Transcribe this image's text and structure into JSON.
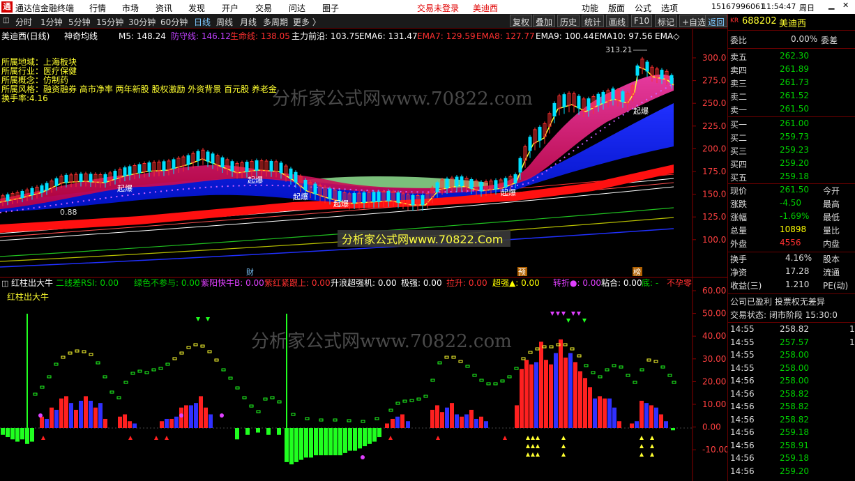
{
  "titlebar": {
    "app": "通达信金融终端",
    "menus": [
      "行情",
      "市场",
      "资讯",
      "发现",
      "开户",
      "交易",
      "问达",
      "圈子"
    ],
    "login": "交易未登录",
    "stock": "美迪西",
    "right_menus": [
      "功能",
      "版面",
      "公式",
      "选项"
    ],
    "phone": "15167996061",
    "time": "11:54:47",
    "weekday": "周日"
  },
  "toolbar": {
    "periods": [
      "分时",
      "1分钟",
      "5分钟",
      "15分钟",
      "30分钟",
      "60分钟",
      "日线",
      "周线",
      "月线",
      "多周期",
      "更多 〉"
    ],
    "selected": "日线",
    "buttons": [
      "复权",
      "叠加",
      "历史",
      "统计",
      "画线",
      "F10",
      "标记",
      "+自选",
      "返回"
    ]
  },
  "kline": {
    "name": "美迪西(日线)",
    "indicator": "神奇均线",
    "ma": [
      {
        "label": "M5: 148.24",
        "color": "#ffffff"
      },
      {
        "label": "防守线: 146.12",
        "color": "#c040ff"
      },
      {
        "label": "生命线: 138.05",
        "color": "#ff3030"
      },
      {
        "label": "主力前沿: 103.75",
        "color": "#ffffff"
      },
      {
        "label": "EMA6: 131.47",
        "color": "#ffffff"
      },
      {
        "label": "EMA7: 129.59",
        "color": "#ff3030"
      },
      {
        "label": "EMA8: 127.77",
        "color": "#ff3030"
      },
      {
        "label": "EMA9: 100.44",
        "color": "#ffffff"
      },
      {
        "label": "EMA10: 97.56",
        "color": "#ffffff"
      },
      {
        "label": "EMA◇",
        "color": "#ffffff"
      }
    ],
    "info": [
      "所属地域：上海板块",
      "所属行业：医疗保健",
      "所属概念：仿制药",
      "所属风格：融资融券 高市净率 两年新股 股权激励 外资背景 百元股 养老金",
      "换手率:4.16"
    ],
    "yticks": [
      "300.0",
      "275.0",
      "250.0",
      "225.0",
      "200.0",
      "175.0",
      "150.0",
      "125.0",
      "100.0"
    ],
    "high": "313.21",
    "low": "0.88",
    "marks": [
      "财",
      "预",
      "榜"
    ],
    "tags": [
      "起爆",
      "起爆",
      "起爆",
      "起爆",
      "起爆",
      "起爆"
    ]
  },
  "sub": {
    "name": "红柱出大牛",
    "items": [
      {
        "label": "二线差RSI: 0.00",
        "color": "#00d000"
      },
      {
        "label": "绿色不参与: 0.00",
        "color": "#00d000"
      },
      {
        "label": "紫阳快牛B: 0.00",
        "color": "#e040ff"
      },
      {
        "label": "紫红紧跟上: 0.00",
        "color": "#ff3030"
      },
      {
        "label": "升浪超强机: 0.00",
        "color": "#ffffff"
      },
      {
        "label": "极强: 0.00",
        "color": "#ffffff"
      },
      {
        "label": "拉升: 0.00",
        "color": "#ff3030"
      },
      {
        "label": "超强▲: 0.00",
        "color": "#ffff00"
      },
      {
        "label": "转折●: 0.00",
        "color": "#e040ff"
      },
      {
        "label": "粘合: 0.00",
        "color": "#ffffff"
      },
      {
        "label": "底: -",
        "color": "#00d000"
      },
      {
        "label": "不孕零",
        "color": "#ff3030"
      }
    ],
    "title": "红柱出大牛",
    "yticks": [
      "60.00",
      "50.00",
      "40.00",
      "30.00",
      "20.00",
      "10.00",
      "0.00",
      "-10.00"
    ]
  },
  "watermark": "分析家公式网www.70822.com",
  "watermark2": "分析家公式网www.70822.Com",
  "quote": {
    "market": "KR",
    "code": "688202",
    "name": "美迪西",
    "wb_label": "委比",
    "wb": "0.00%",
    "wc_label": "委差",
    "asks": [
      {
        "l": "卖五",
        "p": "262.30"
      },
      {
        "l": "卖四",
        "p": "261.89"
      },
      {
        "l": "卖三",
        "p": "261.73"
      },
      {
        "l": "卖二",
        "p": "261.52"
      },
      {
        "l": "卖一",
        "p": "261.50"
      }
    ],
    "bids": [
      {
        "l": "买一",
        "p": "261.00"
      },
      {
        "l": "买二",
        "p": "259.73"
      },
      {
        "l": "买三",
        "p": "259.23"
      },
      {
        "l": "买四",
        "p": "259.20"
      },
      {
        "l": "买五",
        "p": "259.18"
      }
    ],
    "stats": [
      {
        "l": "现价",
        "v": "261.50",
        "r": "今开",
        "c": "g"
      },
      {
        "l": "涨跌",
        "v": "-4.50",
        "r": "最高",
        "c": "g"
      },
      {
        "l": "涨幅",
        "v": "-1.69%",
        "r": "最低",
        "c": "g"
      },
      {
        "l": "总量",
        "v": "10898",
        "r": "量比",
        "c": "y"
      },
      {
        "l": "外盘",
        "v": "4556",
        "r": "内盘",
        "c": "r"
      }
    ],
    "stats2": [
      {
        "l": "换手",
        "v": "4.16%",
        "r": "股本"
      },
      {
        "l": "净资",
        "v": "17.28",
        "r": "流通"
      },
      {
        "l": "收益(三)",
        "v": "1.210",
        "r": "PE(动)"
      }
    ],
    "notice": "公司已盈利 投票权无差异",
    "status": "交易状态: 闭市阶段 15:30:0",
    "ticks": [
      {
        "t": "14:55",
        "p": "258.82",
        "c": "w"
      },
      {
        "t": "14:55",
        "p": "257.57",
        "c": "g"
      },
      {
        "t": "14:55",
        "p": "258.00",
        "c": "g"
      },
      {
        "t": "14:55",
        "p": "258.00",
        "c": "g"
      },
      {
        "t": "14:56",
        "p": "258.00",
        "c": "g"
      },
      {
        "t": "14:56",
        "p": "258.82",
        "c": "g"
      },
      {
        "t": "14:56",
        "p": "258.82",
        "c": "g"
      },
      {
        "t": "14:56",
        "p": "258.82",
        "c": "g"
      },
      {
        "t": "14:56",
        "p": "259.18",
        "c": "g"
      },
      {
        "t": "14:56",
        "p": "258.91",
        "c": "g"
      },
      {
        "t": "14:56",
        "p": "259.18",
        "c": "g"
      },
      {
        "t": "14:56",
        "p": "259.20",
        "c": "g"
      }
    ],
    "tick_vols": [
      "1",
      "1"
    ]
  }
}
